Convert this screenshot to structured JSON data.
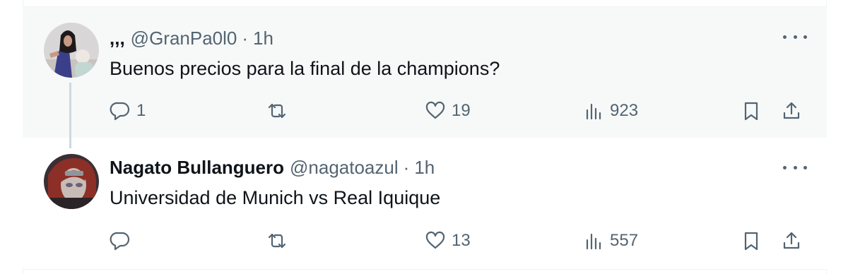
{
  "tweets": [
    {
      "display_name": ",,,",
      "handle": "@GranPa0l0",
      "separator": "·",
      "time": "1h",
      "text": "Buenos precios para la final de la champions?",
      "stats": {
        "replies": "1",
        "retweets": "",
        "likes": "19",
        "views": "923"
      }
    },
    {
      "display_name": "Nagato Bullanguero",
      "handle": "@nagatoazul",
      "separator": "·",
      "time": "1h",
      "text": "Universidad de Munich vs Real Iquique",
      "stats": {
        "replies": "",
        "retweets": "",
        "likes": "13",
        "views": "557"
      }
    }
  ],
  "icons": {
    "reply": "reply-icon",
    "retweet": "retweet-icon",
    "like": "heart-icon",
    "views": "views-icon",
    "bookmark": "bookmark-icon",
    "share": "share-icon",
    "more": "more-icon"
  },
  "colors": {
    "text": "#0f1419",
    "secondary": "#536471",
    "hover_bg": "#f7f9f9",
    "border": "#eff3f4"
  }
}
